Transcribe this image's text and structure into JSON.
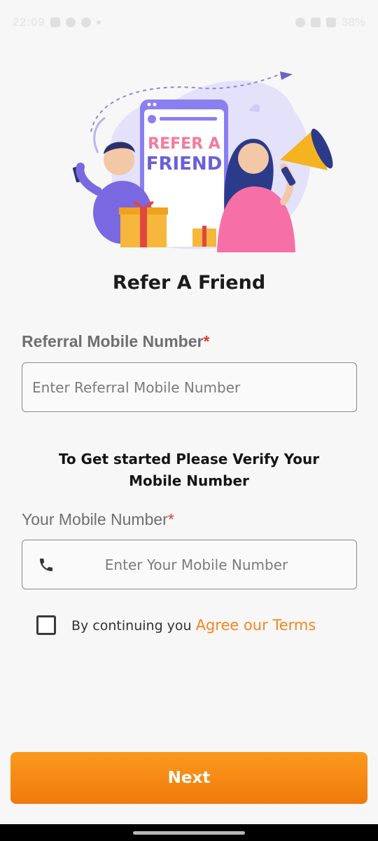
{
  "status_bar": {
    "time": "22:09",
    "battery": "38%"
  },
  "illustration": {
    "phone_text_line1": "REFER A",
    "phone_text_line2": "FRIEND"
  },
  "title": "Refer A Friend",
  "referral_field": {
    "label": "Referral Mobile Number",
    "required_marker": "*",
    "placeholder": "Enter Referral Mobile Number",
    "value": ""
  },
  "verify_note": "To Get started Please Verify Your Mobile Number",
  "mobile_field": {
    "label": "Your Mobile Number",
    "required_marker": "*",
    "placeholder": "Enter Your Mobile Number",
    "value": "",
    "icon": "phone-icon"
  },
  "terms": {
    "checked": false,
    "prefix": "By continuing you",
    "link_text": "Agree our Terms"
  },
  "next_button": {
    "label": "Next"
  },
  "colors": {
    "accent": "#f5841f",
    "button_top": "#fb9a1d",
    "button_bottom": "#f07a0c",
    "required": "#e53935",
    "background": "#f7f7f7"
  }
}
